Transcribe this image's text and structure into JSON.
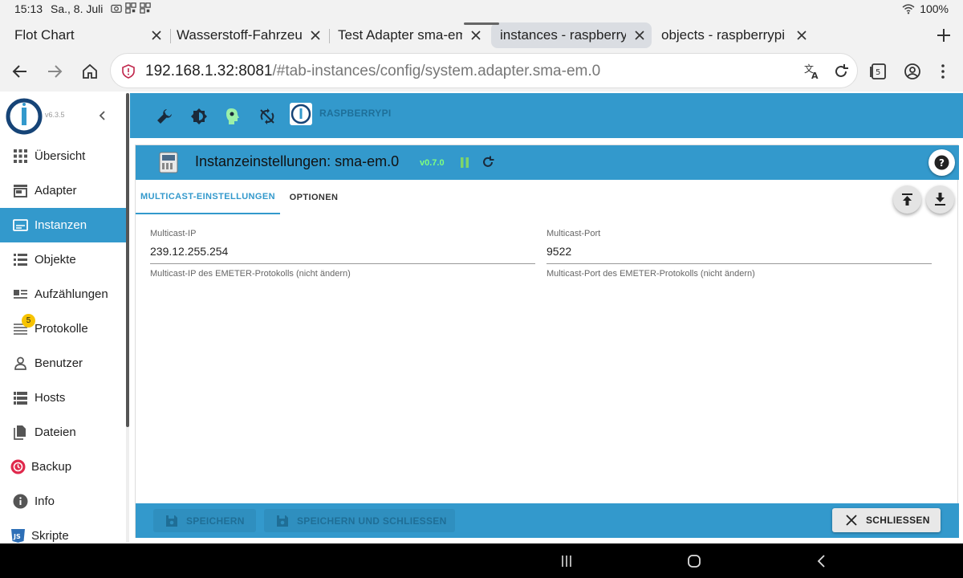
{
  "status_bar": {
    "time": "15:13",
    "date": "Sa., 8. Juli",
    "battery": "100%"
  },
  "browser": {
    "tabs": [
      {
        "label": "Flot Chart",
        "active": false
      },
      {
        "label": "Wasserstoff-Fahrzeug",
        "active": false
      },
      {
        "label": "Test Adapter sma-em",
        "active": false
      },
      {
        "label": "instances - raspberrypi",
        "active": true
      },
      {
        "label": "objects - raspberrypi",
        "active": false
      }
    ],
    "url_host": "192.168.1.32:8081",
    "url_path": "/#tab-instances/config/system.adapter.sma-em.0",
    "tab_count": "5"
  },
  "sidebar": {
    "version": "v6.3.5",
    "items": [
      {
        "label": "Übersicht",
        "icon": "grid-icon"
      },
      {
        "label": "Adapter",
        "icon": "store-icon"
      },
      {
        "label": "Instanzen",
        "icon": "instances-icon",
        "active": true
      },
      {
        "label": "Objekte",
        "icon": "list-icon"
      },
      {
        "label": "Aufzählungen",
        "icon": "enum-icon"
      },
      {
        "label": "Protokolle",
        "icon": "log-icon",
        "badge": "5"
      },
      {
        "label": "Benutzer",
        "icon": "user-icon"
      },
      {
        "label": "Hosts",
        "icon": "hosts-icon"
      },
      {
        "label": "Dateien",
        "icon": "files-icon"
      },
      {
        "label": "Backup",
        "icon": "backup-icon"
      },
      {
        "label": "Info",
        "icon": "info-icon"
      },
      {
        "label": "Skripte",
        "icon": "js-icon"
      }
    ]
  },
  "topbar": {
    "host": "RASPBERRYPI"
  },
  "panel": {
    "title": "Instanzeinstellungen: sma-em.0",
    "version": "v0.7.0",
    "tabs": [
      {
        "label": "MULTICAST-EINSTELLUNGEN",
        "active": true
      },
      {
        "label": "OPTIONEN",
        "active": false
      }
    ],
    "fields": [
      {
        "label": "Multicast-IP",
        "value": "239.12.255.254",
        "help": "Multicast-IP des EMETER-Protokolls (nicht ändern)"
      },
      {
        "label": "Multicast-Port",
        "value": "9522",
        "help": "Multicast-Port des EMETER-Protokolls (nicht ändern)"
      }
    ],
    "footer": {
      "save": "SPEICHERN",
      "save_close": "SPEICHERN UND SCHLIESSEN",
      "close": "SCHLIESSEN"
    }
  },
  "colors": {
    "accent": "#3399cc",
    "version_green": "#7fff7f",
    "badge": "#f7c300"
  }
}
